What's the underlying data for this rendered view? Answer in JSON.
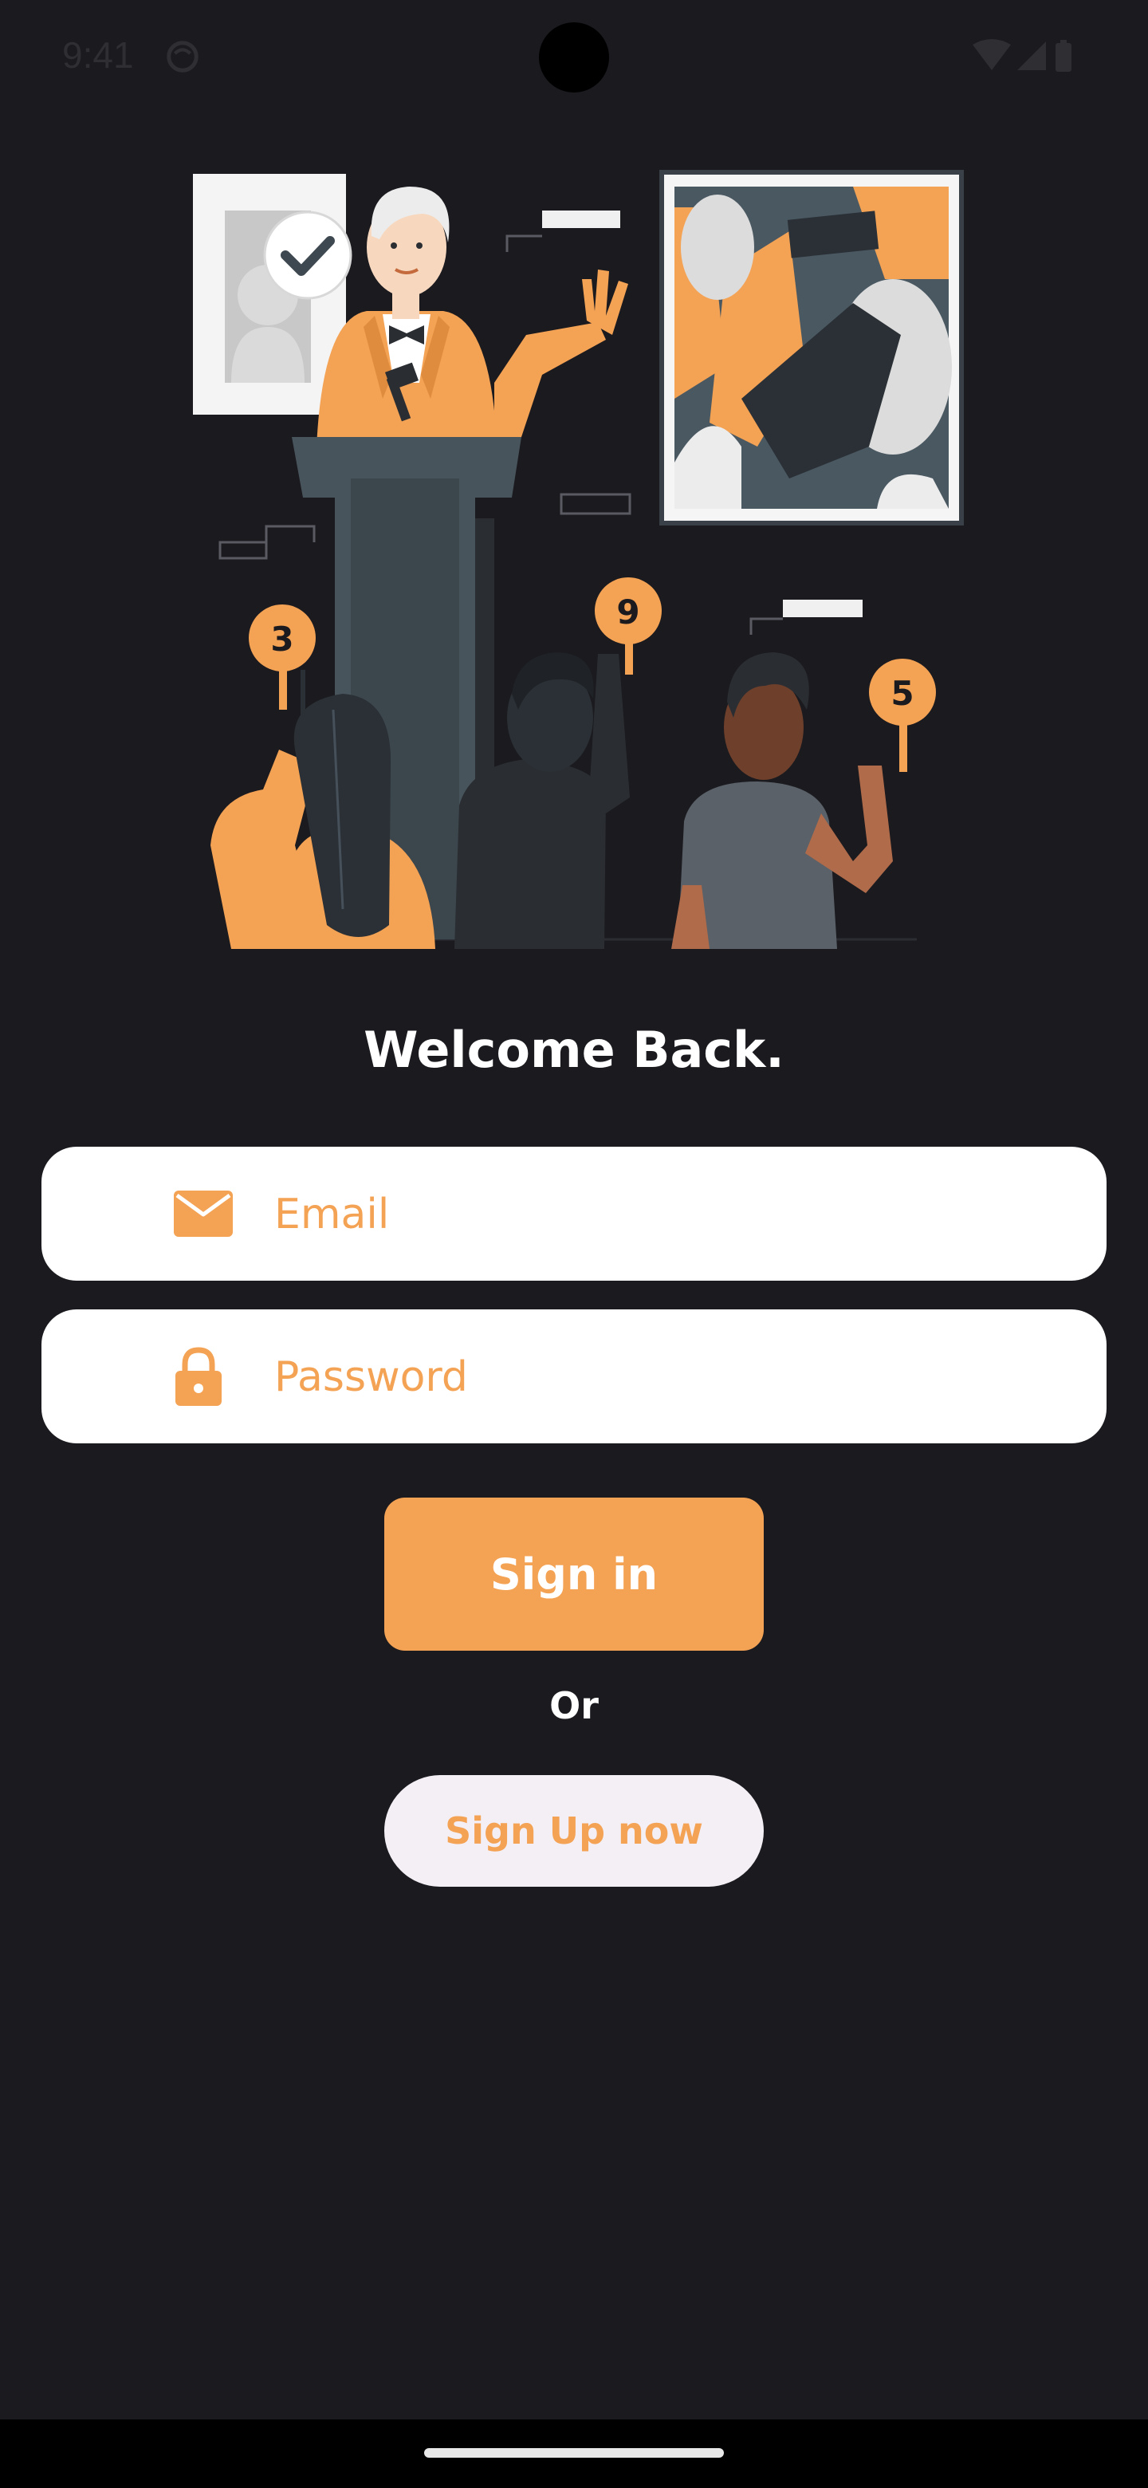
{
  "status_bar": {
    "time": "9:41",
    "icons": [
      "sync-icon",
      "wifi-icon",
      "signal-icon",
      "battery-icon"
    ]
  },
  "illustration": {
    "paddle_numbers": [
      "3",
      "9",
      "5"
    ]
  },
  "login": {
    "title": "Welcome Back.",
    "email_placeholder": "Email",
    "email_icon": "mail-icon",
    "password_placeholder": "Password",
    "password_icon": "lock-icon",
    "signin_label": "Sign in",
    "or_label": "Or",
    "signup_label": "Sign Up now"
  },
  "colors": {
    "background": "#1a1a1f",
    "accent": "#f4a254",
    "field_bg": "#ffffff",
    "signup_bg": "#f3eff5"
  }
}
